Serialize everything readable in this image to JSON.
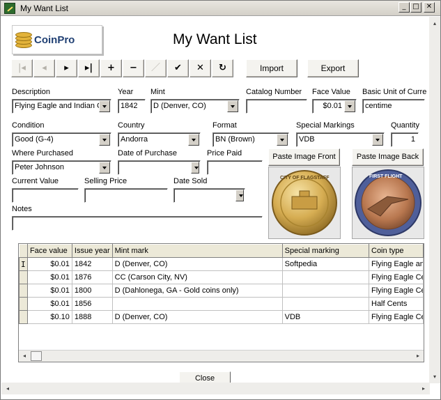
{
  "window": {
    "title": "My Want List",
    "controls": {
      "minimize": "_",
      "maximize": "□",
      "close": "✕"
    }
  },
  "logo": {
    "text": "CoinPro"
  },
  "page_title": "My Want List",
  "nav": {
    "first": "|◂",
    "prev": "◂",
    "next": "▸",
    "last": "▸|",
    "add": "+",
    "delete": "−",
    "edit": "／",
    "post": "✔",
    "cancel": "✕",
    "refresh": "↻"
  },
  "actions": {
    "import": "Import",
    "export": "Export",
    "close": "Close"
  },
  "form": {
    "description": {
      "label": "Description",
      "value": "Flying Eagle and Indian Ce"
    },
    "year": {
      "label": "Year",
      "value": "1842"
    },
    "mint": {
      "label": "Mint",
      "value": "D (Denver, CO)"
    },
    "catalog_number": {
      "label": "Catalog Number",
      "value": ""
    },
    "face_value": {
      "label": "Face Value",
      "value": "$0.01"
    },
    "basic_unit": {
      "label": "Basic Unit of Curre",
      "value": "centime"
    },
    "condition": {
      "label": "Condition",
      "value": "Good (G-4)"
    },
    "country": {
      "label": "Country",
      "value": "Andorra"
    },
    "format": {
      "label": "Format",
      "value": "BN (Brown)"
    },
    "special_markings": {
      "label": "Special Markings",
      "value": "VDB"
    },
    "quantity": {
      "label": "Quantity",
      "value": "1"
    },
    "where_purchased": {
      "label": "Where Purchased",
      "value": "Peter Johnson"
    },
    "date_of_purchase": {
      "label": "Date of Purchase",
      "value": ""
    },
    "price_paid": {
      "label": "Price Paid",
      "value": ""
    },
    "current_value": {
      "label": "Current Value",
      "value": ""
    },
    "selling_price": {
      "label": "Selling Price",
      "value": ""
    },
    "date_sold": {
      "label": "Date Sold",
      "value": ""
    },
    "notes": {
      "label": "Notes",
      "value": ""
    }
  },
  "images": {
    "paste_front": "Paste Image Front",
    "paste_back": "Paste Image Back",
    "front_coin_text": "CITY OF FLAGSTAFF",
    "back_coin_text": "FIRST FLIGHT"
  },
  "grid": {
    "columns": [
      "Face value",
      "Issue year",
      "Mint mark",
      "Special marking",
      "Coin type"
    ],
    "rows": [
      {
        "face_value": "$0.01",
        "issue_year": "1842",
        "mint_mark": "D (Denver, CO)",
        "special_marking": "Softpedia",
        "coin_type": "Flying Eagle and"
      },
      {
        "face_value": "$0.01",
        "issue_year": "1876",
        "mint_mark": "CC (Carson City, NV)",
        "special_marking": "",
        "coin_type": "Flying Eagle Cen"
      },
      {
        "face_value": "$0.01",
        "issue_year": "1800",
        "mint_mark": "D (Dahlonega, GA - Gold coins only)",
        "special_marking": "",
        "coin_type": "Flying Eagle Cen"
      },
      {
        "face_value": "$0.01",
        "issue_year": "1856",
        "mint_mark": "",
        "special_marking": "",
        "coin_type": "Half Cents"
      },
      {
        "face_value": "$0.10",
        "issue_year": "1888",
        "mint_mark": "D (Denver, CO)",
        "special_marking": "VDB",
        "coin_type": "Flying Eagle Cen"
      }
    ]
  },
  "colors": {
    "window_bg": "#ffffff",
    "chrome": "#d4d0c8",
    "logo_text": "#1f3f73",
    "coin_gold": "#e3b33a"
  }
}
